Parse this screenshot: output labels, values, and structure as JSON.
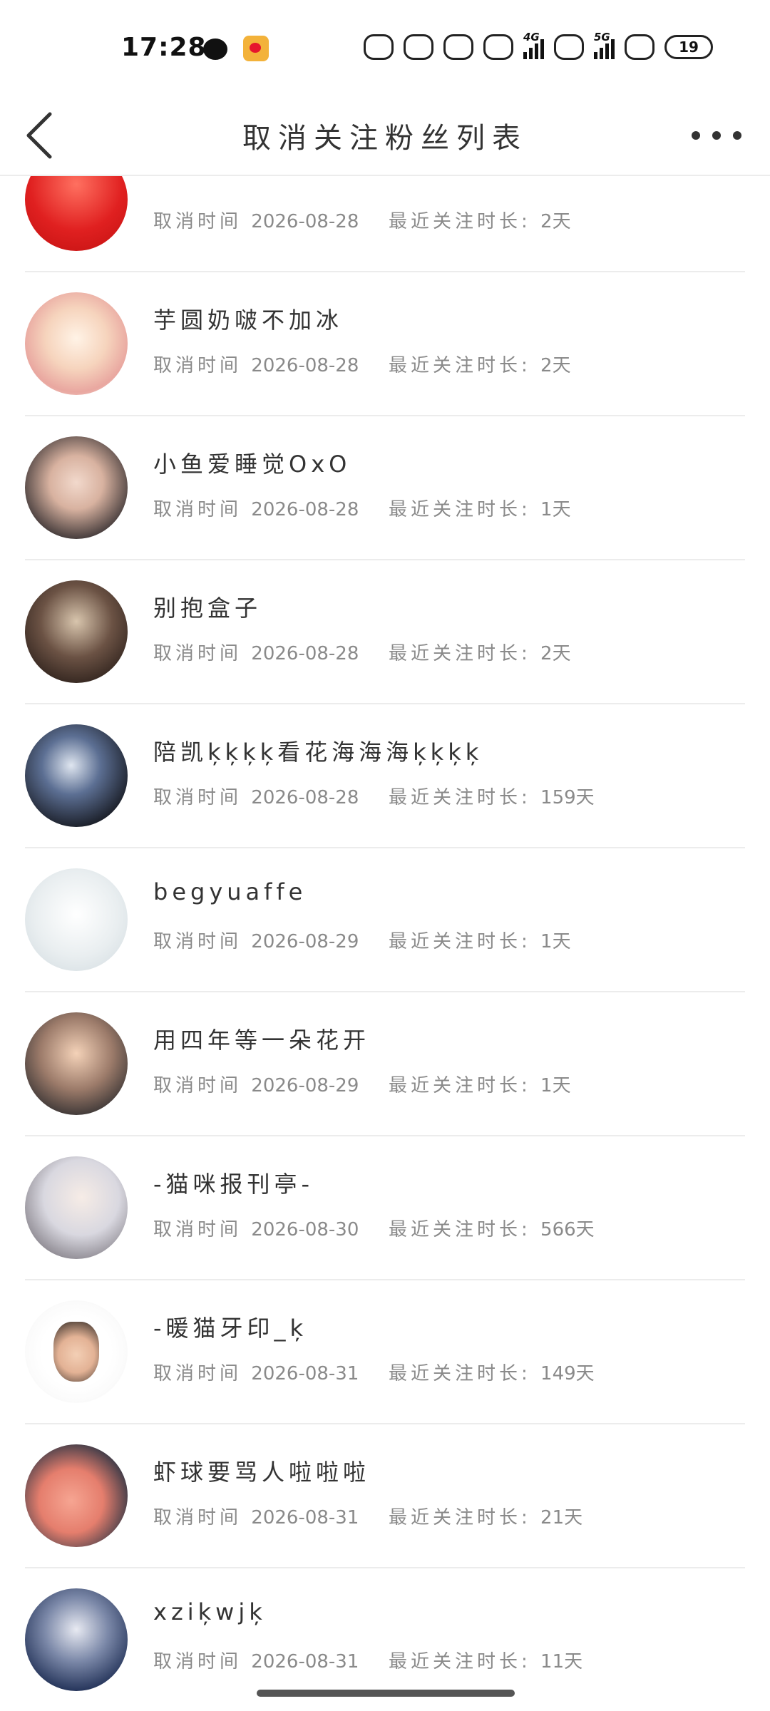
{
  "status_bar": {
    "time": "17:28",
    "net_4g": "4G",
    "net_5g": "5G",
    "battery": "19"
  },
  "header": {
    "title": "取消关注粉丝列表"
  },
  "rows": [
    {
      "name": "",
      "cancel_label": "取消时间",
      "date": "2026-08-28",
      "duration_label": "最近关注时长:",
      "duration": "2天",
      "avatar": "av-red"
    },
    {
      "name": "芋圆奶啵不加冰",
      "cancel_label": "取消时间",
      "date": "2026-08-28",
      "duration_label": "最近关注时长:",
      "duration": "2天",
      "avatar": "av-sheep"
    },
    {
      "name": "小鱼爱睡觉OxO",
      "cancel_label": "取消时间",
      "date": "2026-08-28",
      "duration_label": "最近关注时长:",
      "duration": "1天",
      "avatar": "av-child"
    },
    {
      "name": "别抱盒子",
      "cancel_label": "取消时间",
      "date": "2026-08-28",
      "duration_label": "最近关注时长:",
      "duration": "2天",
      "avatar": "av-robe"
    },
    {
      "name": "陪凯ķķķķ看花海海海ķķķķ",
      "cancel_label": "取消时间",
      "date": "2026-08-28",
      "duration_label": "最近关注时长:",
      "duration": "159天",
      "avatar": "av-stage"
    },
    {
      "name": "begyuaffe",
      "cancel_label": "取消时间",
      "date": "2026-08-29",
      "duration_label": "最近关注时长:",
      "duration": "1天",
      "avatar": "av-doodle"
    },
    {
      "name": "用四年等一朵花开",
      "cancel_label": "取消时间",
      "date": "2026-08-29",
      "duration_label": "最近关注时长:",
      "duration": "1天",
      "avatar": "av-smile"
    },
    {
      "name": "-猫咪报刊亭-",
      "cancel_label": "取消时间",
      "date": "2026-08-30",
      "duration_label": "最近关注时长:",
      "duration": "566天",
      "avatar": "av-boy"
    },
    {
      "name": "-暖猫牙印_ķ",
      "cancel_label": "取消时间",
      "date": "2026-08-31",
      "duration_label": "最近关注时长:",
      "duration": "149天",
      "avatar": "av-baby"
    },
    {
      "name": "虾球要骂人啦啦啦",
      "cancel_label": "取消时间",
      "date": "2026-08-31",
      "duration_label": "最近关注时长:",
      "duration": "21天",
      "avatar": "av-fluff"
    },
    {
      "name": "xziķwjķ",
      "cancel_label": "取消时间",
      "date": "2026-08-31",
      "duration_label": "最近关注时长:",
      "duration": "11天",
      "avatar": "av-white"
    }
  ]
}
